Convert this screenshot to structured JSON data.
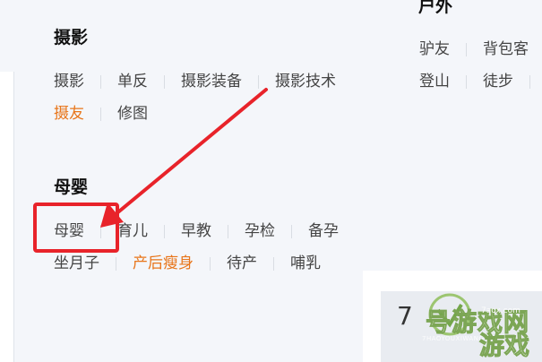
{
  "outdoor": {
    "title": "户外",
    "row1": [
      "驴友",
      "背包客"
    ],
    "row2": [
      "登山",
      "徒步"
    ]
  },
  "photography": {
    "title": "摄影",
    "row1": [
      "摄影",
      "单反",
      "摄影装备",
      "摄影技术"
    ],
    "row2": [
      "摄友",
      "修图"
    ]
  },
  "maternity": {
    "title": "母婴",
    "row1": [
      "母婴",
      "育儿",
      "早教",
      "孕检",
      "备孕"
    ],
    "row2": [
      "坐月子",
      "产后瘦身",
      "待产",
      "哺乳"
    ]
  },
  "bottom_card": {
    "leading_text": "7"
  },
  "watermark": {
    "main_text": "号游戏网",
    "url_text": "7aox.com",
    "pinyin_text": "7HAOYOUXIWANG",
    "secondary_text": "游戏"
  },
  "colors": {
    "hot_tag": "#e8751a",
    "highlight": "#e8232a",
    "arrow": "#e8232a"
  }
}
